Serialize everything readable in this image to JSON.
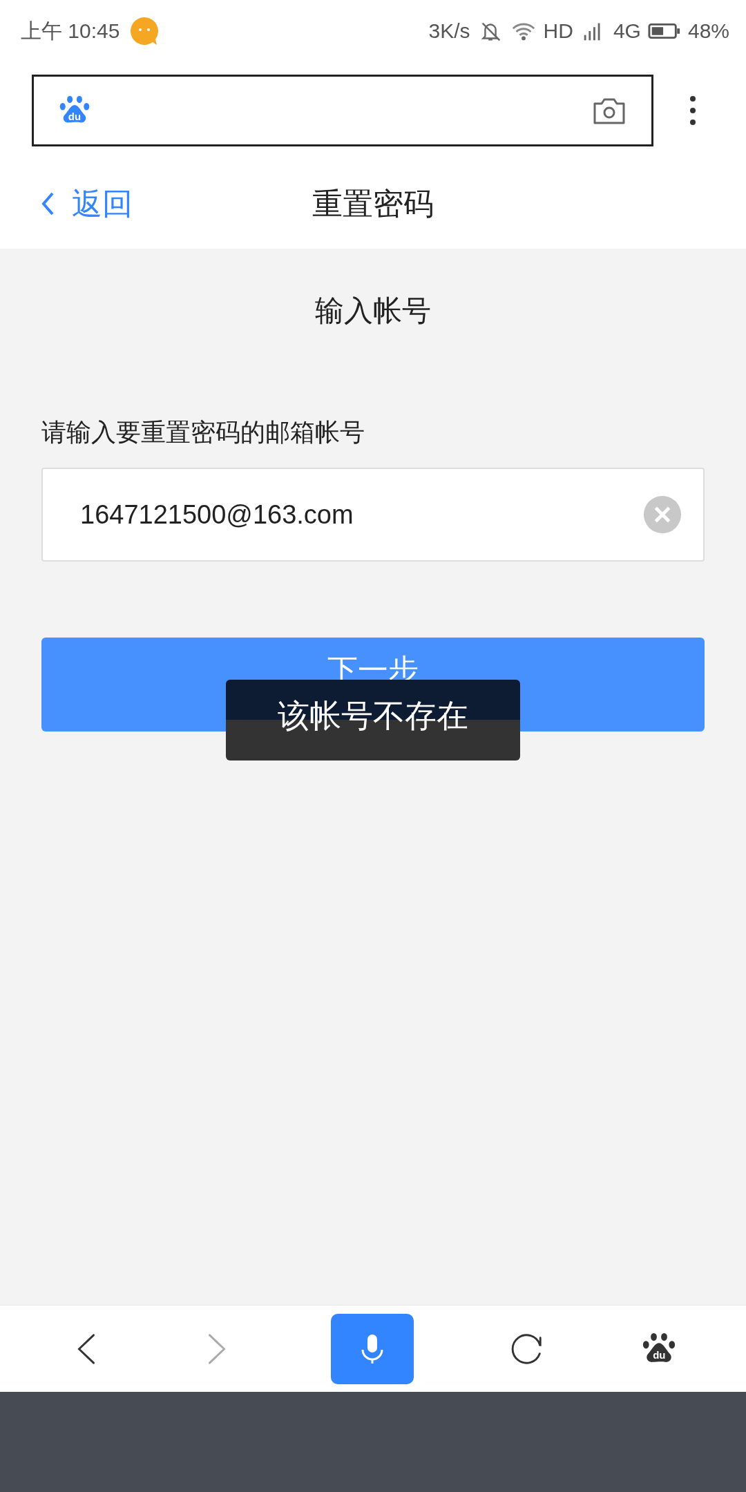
{
  "status_bar": {
    "time": "上午 10:45",
    "speed": "3K/s",
    "hd": "HD",
    "network": "4G",
    "battery": "48%"
  },
  "address_bar": {
    "logo_text": "du"
  },
  "header": {
    "back": "返回",
    "title": "重置密码"
  },
  "page": {
    "heading": "输入帐号",
    "label": "请输入要重置密码的邮箱帐号",
    "value": "1647121500@163.com",
    "button": "下一步"
  },
  "toast": "该帐号不存在",
  "bottom_bar": {
    "items": [
      {
        "kind": "back",
        "disabled": false
      },
      {
        "kind": "forward",
        "disabled": true
      },
      {
        "kind": "voice",
        "disabled": false
      },
      {
        "kind": "refresh",
        "disabled": false
      },
      {
        "kind": "home",
        "disabled": false,
        "text": "du"
      }
    ]
  }
}
